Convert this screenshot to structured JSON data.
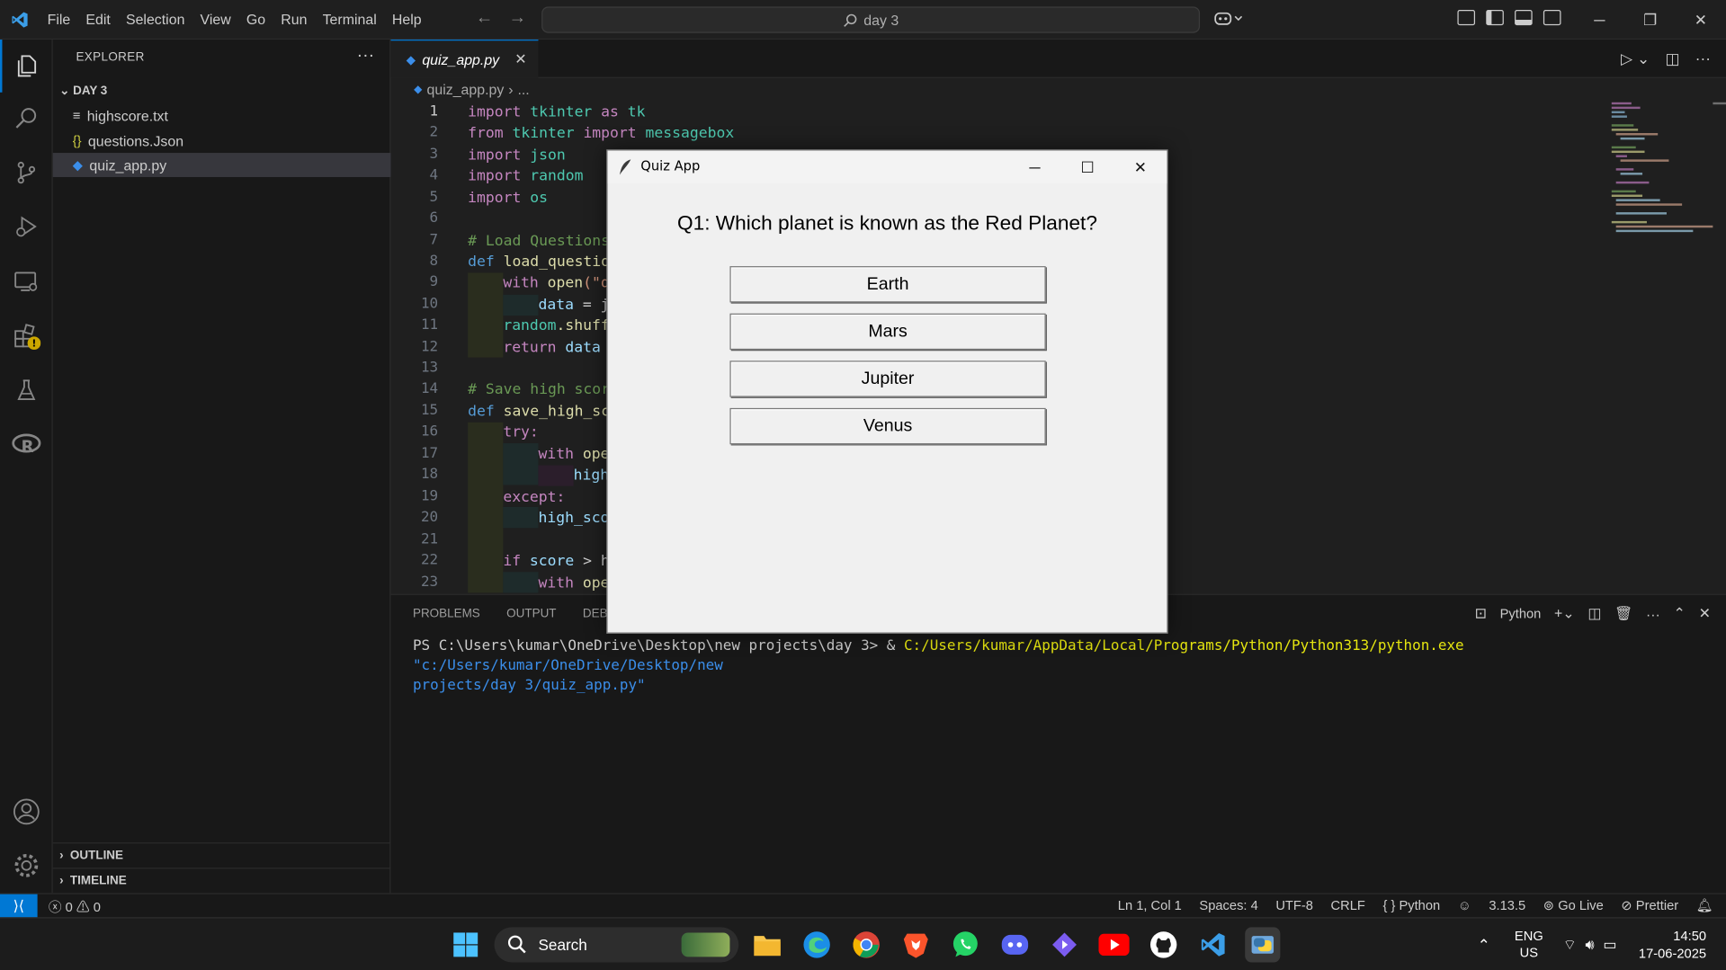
{
  "titlebar": {
    "menu": [
      "File",
      "Edit",
      "Selection",
      "View",
      "Go",
      "Run",
      "Terminal",
      "Help"
    ],
    "search_text": "day 3"
  },
  "explorer": {
    "title": "EXPLORER",
    "folder": "DAY 3",
    "files": [
      "highscore.txt",
      "questions.Json",
      "quiz_app.py"
    ],
    "outline": "OUTLINE",
    "timeline": "TIMELINE"
  },
  "editor": {
    "tab": "quiz_app.py",
    "breadcrumb_file": "quiz_app.py",
    "breadcrumb_more": "...",
    "line_numbers": [
      "1",
      "2",
      "3",
      "4",
      "5",
      "6",
      "7",
      "8",
      "9",
      "10",
      "11",
      "12",
      "13",
      "14",
      "15",
      "16",
      "17",
      "18",
      "19",
      "20",
      "21",
      "22",
      "23"
    ],
    "code": {
      "l1": [
        "import",
        "tkinter",
        "as",
        "tk"
      ],
      "l2": [
        "from",
        "tkinter",
        "import",
        "messagebox"
      ],
      "l3": [
        "import",
        "json"
      ],
      "l4": [
        "import",
        "random"
      ],
      "l5": [
        "import",
        "os"
      ],
      "l7": "# Load Questions",
      "l8": [
        "def",
        "load_questio"
      ],
      "l9": [
        "with",
        "open",
        "(\"q"
      ],
      "l10": [
        "data",
        " = j"
      ],
      "l11": [
        "random",
        ".shuff"
      ],
      "l12": [
        "return",
        "data"
      ],
      "l14": "# Save high scor",
      "l15": [
        "def",
        "save_high_sc"
      ],
      "l16": "try:",
      "l17": [
        "with",
        "ope"
      ],
      "l18": "high",
      "l19": "except:",
      "l20": "high_sco",
      "l22": [
        "if",
        "score",
        " > h"
      ],
      "l23": [
        "with",
        "ope"
      ]
    }
  },
  "panel": {
    "tabs": [
      "PROBLEMS",
      "OUTPUT",
      "DEBU"
    ],
    "shell_label": "Python",
    "terminal": {
      "prompt": "PS C:\\Users\\kumar\\OneDrive\\Desktop\\new projects\\day 3> & ",
      "exe": "C:/Users/kumar/AppData/Local/Programs/Python/Python313/python.exe",
      "arg1": " \"c:/Users/kumar/OneDrive/Desktop/new",
      "arg2": "projects/day 3/quiz_app.py\""
    }
  },
  "statusbar": {
    "errors": "0",
    "warnings": "0",
    "position": "Ln 1, Col 1",
    "spaces": "Spaces: 4",
    "encoding": "UTF-8",
    "eol": "CRLF",
    "language": "Python",
    "python_version": "3.13.5",
    "golive": "Go Live",
    "prettier": "Prettier"
  },
  "quiz_app": {
    "window_title": "Quiz App",
    "question": "Q1: Which planet is known as the Red Planet?",
    "options": [
      "Earth",
      "Mars",
      "Jupiter",
      "Venus"
    ]
  },
  "taskbar": {
    "search_label": "Search",
    "lang_top": "ENG",
    "lang_bottom": "US",
    "time": "14:50",
    "date": "17-06-2025"
  }
}
